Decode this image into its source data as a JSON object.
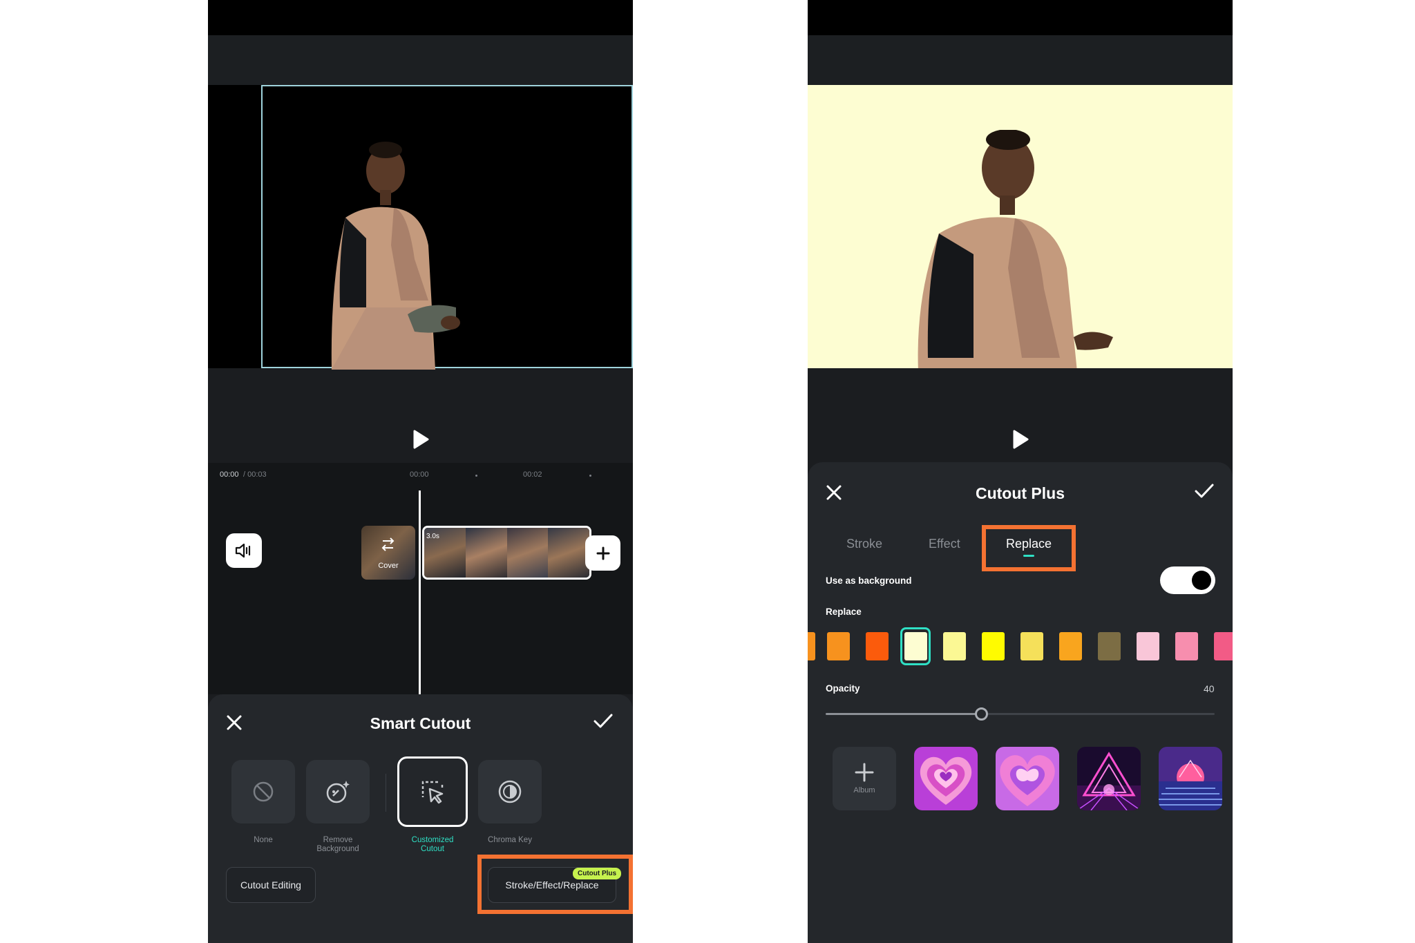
{
  "left": {
    "timeline": {
      "current_time": "00:00",
      "total_time": "/ 00:03",
      "ruler_marks": [
        "00:00",
        "00:02"
      ],
      "cover_label": "Cover",
      "clip_duration": "3.0s"
    },
    "sheet": {
      "title": "Smart Cutout",
      "tools": [
        {
          "label": "None",
          "icon": "prohibit-icon",
          "active": false
        },
        {
          "label": "Remove Background",
          "icon": "magic-wand-icon",
          "active": false
        },
        {
          "label": "Customized Cutout",
          "icon": "cursor-select-icon",
          "active": true
        },
        {
          "label": "Chroma Key",
          "icon": "chroma-key-icon",
          "active": false
        }
      ],
      "cutout_editing_label": "Cutout Editing",
      "stroke_effect_replace_label": "Stroke/Effect/Replace",
      "badge_label": "Cutout Plus"
    }
  },
  "right": {
    "sheet": {
      "title": "Cutout Plus",
      "tabs": [
        "Stroke",
        "Effect",
        "Replace"
      ],
      "active_tab": "Replace",
      "use_as_background_label": "Use as background",
      "use_as_background_on": true,
      "replace_label": "Replace",
      "swatches": [
        "#f7921e",
        "#f7921e",
        "#fb5b0c",
        "#fdfdd2",
        "#fbf894",
        "#fffb00",
        "#f5e05a",
        "#f9a51e",
        "#7c6d44",
        "#f9c6d8",
        "#f78eae",
        "#f25b86"
      ],
      "selected_swatch": "#fdfdd2",
      "opacity_label": "Opacity",
      "opacity_value": "40",
      "album_label": "Album",
      "background_thumbnails": [
        "pink-heart-tunnel",
        "purple-butterfly-heart",
        "neon-triangle-grid",
        "neon-sunset-ocean"
      ]
    }
  },
  "colors": {
    "accent": "#2fe0c5",
    "highlight": "#f47232",
    "badge": "#c6f24e",
    "panel": "#24272b"
  }
}
